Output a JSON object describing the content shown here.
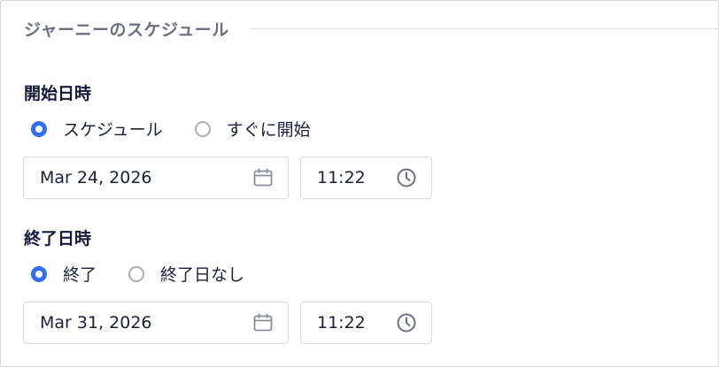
{
  "section": {
    "title": "ジャーニーのスケジュール"
  },
  "start": {
    "label": "開始日時",
    "options": [
      {
        "label": "スケジュール",
        "checked": true
      },
      {
        "label": "すぐに開始",
        "checked": false
      }
    ],
    "date": "Mar 24, 2026",
    "time": "11:22"
  },
  "end": {
    "label": "終了日時",
    "options": [
      {
        "label": "終了",
        "checked": true
      },
      {
        "label": "終了日なし",
        "checked": false
      }
    ],
    "date": "Mar 31, 2026",
    "time": "11:22"
  },
  "icons": {
    "date": "calendar-icon",
    "time": "clock-icon"
  },
  "colors": {
    "accent": "#2e6df6",
    "border": "#d7d9e0",
    "muted": "#6b6f82",
    "text": "#14183a"
  }
}
